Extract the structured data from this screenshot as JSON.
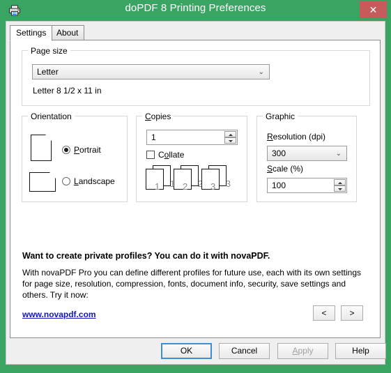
{
  "window": {
    "title": "doPDF 8 Printing Preferences",
    "icon": "printer-icon",
    "close_label": "✕",
    "titlebar_color": "#3aa563",
    "close_color": "#c75b5b"
  },
  "tabs": [
    {
      "label": "Settings",
      "active": true
    },
    {
      "label": "About",
      "active": false
    }
  ],
  "page_size": {
    "group_title_pre": "Pa",
    "group_title_accel": "g",
    "group_title_post": "e size",
    "selected": "Letter",
    "description": "Letter 8 1/2 x 11 in",
    "chevron": "⌄"
  },
  "orientation": {
    "group_title": "Orientation",
    "options": [
      {
        "accel": "P",
        "rest": "ortrait",
        "selected": true
      },
      {
        "accel": "L",
        "rest": "andscape",
        "selected": false
      }
    ]
  },
  "copies": {
    "group_title_accel": "C",
    "group_title_post": "opies",
    "value": "1",
    "collate": {
      "pre": "C",
      "accel": "o",
      "post": "llate",
      "checked": false
    },
    "preview_numbers": [
      "1",
      "2",
      "3"
    ]
  },
  "graphic": {
    "group_title": "Graphic",
    "resolution": {
      "accel": "R",
      "rest": "esolution (dpi)",
      "value": "300",
      "chevron": "⌄"
    },
    "scale": {
      "accel": "S",
      "rest": "cale (%)",
      "value": "100"
    }
  },
  "promo": {
    "headline": "Want to create private profiles? You can do it with novaPDF.",
    "body": "With novaPDF Pro you can define different profiles for future use, each with its own settings for page size, resolution, compression, fonts, document info, security, save settings and others. Try it now:",
    "link": "www.novapdf.com",
    "link_color": "#1414c8",
    "prev_label": "<",
    "next_label": ">"
  },
  "footer": {
    "ok": "OK",
    "cancel": "Cancel",
    "apply_accel": "A",
    "apply_rest": "pply",
    "apply_disabled": true,
    "help": "Help"
  }
}
